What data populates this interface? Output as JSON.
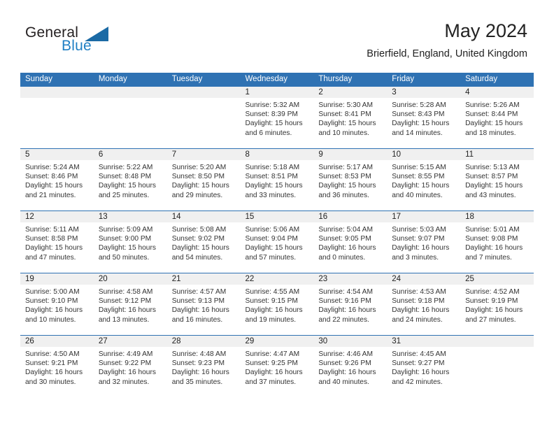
{
  "brand": {
    "word_general": "General",
    "word_blue": "Blue",
    "logo_icon": "triangle-logo-icon",
    "accent_color": "#2f72b3"
  },
  "header": {
    "title": "May 2024",
    "subtitle": "Brierfield, England, United Kingdom"
  },
  "calendar": {
    "weekday_headers": [
      "Sunday",
      "Monday",
      "Tuesday",
      "Wednesday",
      "Thursday",
      "Friday",
      "Saturday"
    ],
    "header_bg": "#2f72b3",
    "daynum_band_bg": "#f0f0f0",
    "weeks": [
      [
        {
          "day": "",
          "lines": []
        },
        {
          "day": "",
          "lines": []
        },
        {
          "day": "",
          "lines": []
        },
        {
          "day": "1",
          "lines": [
            "Sunrise: 5:32 AM",
            "Sunset: 8:39 PM",
            "Daylight: 15 hours",
            "and 6 minutes."
          ]
        },
        {
          "day": "2",
          "lines": [
            "Sunrise: 5:30 AM",
            "Sunset: 8:41 PM",
            "Daylight: 15 hours",
            "and 10 minutes."
          ]
        },
        {
          "day": "3",
          "lines": [
            "Sunrise: 5:28 AM",
            "Sunset: 8:43 PM",
            "Daylight: 15 hours",
            "and 14 minutes."
          ]
        },
        {
          "day": "4",
          "lines": [
            "Sunrise: 5:26 AM",
            "Sunset: 8:44 PM",
            "Daylight: 15 hours",
            "and 18 minutes."
          ]
        }
      ],
      [
        {
          "day": "5",
          "lines": [
            "Sunrise: 5:24 AM",
            "Sunset: 8:46 PM",
            "Daylight: 15 hours",
            "and 21 minutes."
          ]
        },
        {
          "day": "6",
          "lines": [
            "Sunrise: 5:22 AM",
            "Sunset: 8:48 PM",
            "Daylight: 15 hours",
            "and 25 minutes."
          ]
        },
        {
          "day": "7",
          "lines": [
            "Sunrise: 5:20 AM",
            "Sunset: 8:50 PM",
            "Daylight: 15 hours",
            "and 29 minutes."
          ]
        },
        {
          "day": "8",
          "lines": [
            "Sunrise: 5:18 AM",
            "Sunset: 8:51 PM",
            "Daylight: 15 hours",
            "and 33 minutes."
          ]
        },
        {
          "day": "9",
          "lines": [
            "Sunrise: 5:17 AM",
            "Sunset: 8:53 PM",
            "Daylight: 15 hours",
            "and 36 minutes."
          ]
        },
        {
          "day": "10",
          "lines": [
            "Sunrise: 5:15 AM",
            "Sunset: 8:55 PM",
            "Daylight: 15 hours",
            "and 40 minutes."
          ]
        },
        {
          "day": "11",
          "lines": [
            "Sunrise: 5:13 AM",
            "Sunset: 8:57 PM",
            "Daylight: 15 hours",
            "and 43 minutes."
          ]
        }
      ],
      [
        {
          "day": "12",
          "lines": [
            "Sunrise: 5:11 AM",
            "Sunset: 8:58 PM",
            "Daylight: 15 hours",
            "and 47 minutes."
          ]
        },
        {
          "day": "13",
          "lines": [
            "Sunrise: 5:09 AM",
            "Sunset: 9:00 PM",
            "Daylight: 15 hours",
            "and 50 minutes."
          ]
        },
        {
          "day": "14",
          "lines": [
            "Sunrise: 5:08 AM",
            "Sunset: 9:02 PM",
            "Daylight: 15 hours",
            "and 54 minutes."
          ]
        },
        {
          "day": "15",
          "lines": [
            "Sunrise: 5:06 AM",
            "Sunset: 9:04 PM",
            "Daylight: 15 hours",
            "and 57 minutes."
          ]
        },
        {
          "day": "16",
          "lines": [
            "Sunrise: 5:04 AM",
            "Sunset: 9:05 PM",
            "Daylight: 16 hours",
            "and 0 minutes."
          ]
        },
        {
          "day": "17",
          "lines": [
            "Sunrise: 5:03 AM",
            "Sunset: 9:07 PM",
            "Daylight: 16 hours",
            "and 3 minutes."
          ]
        },
        {
          "day": "18",
          "lines": [
            "Sunrise: 5:01 AM",
            "Sunset: 9:08 PM",
            "Daylight: 16 hours",
            "and 7 minutes."
          ]
        }
      ],
      [
        {
          "day": "19",
          "lines": [
            "Sunrise: 5:00 AM",
            "Sunset: 9:10 PM",
            "Daylight: 16 hours",
            "and 10 minutes."
          ]
        },
        {
          "day": "20",
          "lines": [
            "Sunrise: 4:58 AM",
            "Sunset: 9:12 PM",
            "Daylight: 16 hours",
            "and 13 minutes."
          ]
        },
        {
          "day": "21",
          "lines": [
            "Sunrise: 4:57 AM",
            "Sunset: 9:13 PM",
            "Daylight: 16 hours",
            "and 16 minutes."
          ]
        },
        {
          "day": "22",
          "lines": [
            "Sunrise: 4:55 AM",
            "Sunset: 9:15 PM",
            "Daylight: 16 hours",
            "and 19 minutes."
          ]
        },
        {
          "day": "23",
          "lines": [
            "Sunrise: 4:54 AM",
            "Sunset: 9:16 PM",
            "Daylight: 16 hours",
            "and 22 minutes."
          ]
        },
        {
          "day": "24",
          "lines": [
            "Sunrise: 4:53 AM",
            "Sunset: 9:18 PM",
            "Daylight: 16 hours",
            "and 24 minutes."
          ]
        },
        {
          "day": "25",
          "lines": [
            "Sunrise: 4:52 AM",
            "Sunset: 9:19 PM",
            "Daylight: 16 hours",
            "and 27 minutes."
          ]
        }
      ],
      [
        {
          "day": "26",
          "lines": [
            "Sunrise: 4:50 AM",
            "Sunset: 9:21 PM",
            "Daylight: 16 hours",
            "and 30 minutes."
          ]
        },
        {
          "day": "27",
          "lines": [
            "Sunrise: 4:49 AM",
            "Sunset: 9:22 PM",
            "Daylight: 16 hours",
            "and 32 minutes."
          ]
        },
        {
          "day": "28",
          "lines": [
            "Sunrise: 4:48 AM",
            "Sunset: 9:23 PM",
            "Daylight: 16 hours",
            "and 35 minutes."
          ]
        },
        {
          "day": "29",
          "lines": [
            "Sunrise: 4:47 AM",
            "Sunset: 9:25 PM",
            "Daylight: 16 hours",
            "and 37 minutes."
          ]
        },
        {
          "day": "30",
          "lines": [
            "Sunrise: 4:46 AM",
            "Sunset: 9:26 PM",
            "Daylight: 16 hours",
            "and 40 minutes."
          ]
        },
        {
          "day": "31",
          "lines": [
            "Sunrise: 4:45 AM",
            "Sunset: 9:27 PM",
            "Daylight: 16 hours",
            "and 42 minutes."
          ]
        },
        {
          "day": "",
          "lines": []
        }
      ]
    ]
  }
}
